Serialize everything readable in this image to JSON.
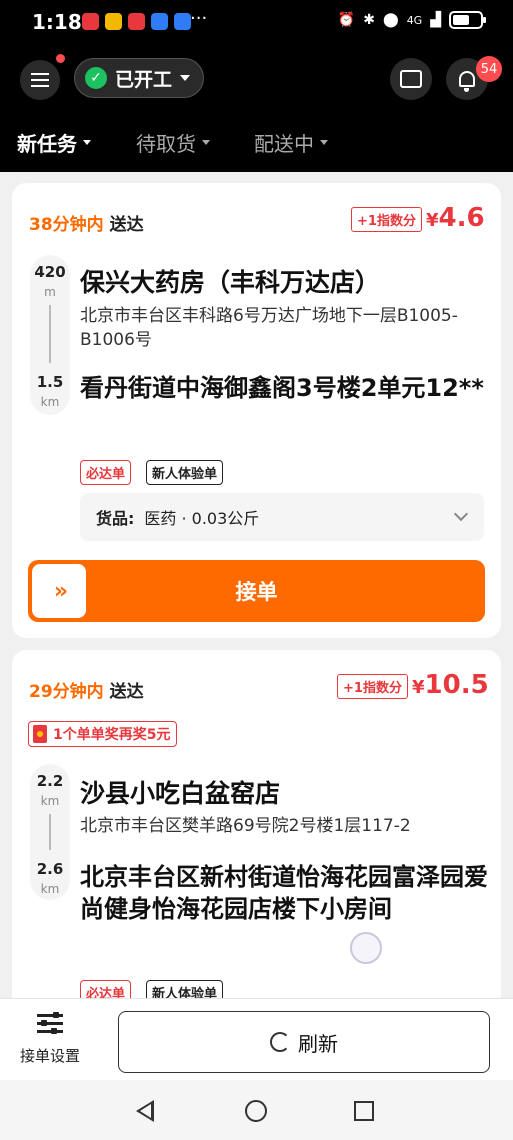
{
  "status_bar": {
    "time": "1:18",
    "more": "···",
    "network": "4G",
    "app_icons": [
      {
        "name": "app-icon-1",
        "color": "#e8383d"
      },
      {
        "name": "app-icon-2",
        "color": "#f5b800"
      },
      {
        "name": "app-icon-3",
        "color": "#e8383d"
      },
      {
        "name": "app-icon-4",
        "color": "#2f7cf6"
      },
      {
        "name": "app-icon-5",
        "color": "#2f7cf6"
      }
    ]
  },
  "header": {
    "work_status": "已开工",
    "notification_count": "54",
    "tabs": [
      "新任务",
      "待取货",
      "配送中"
    ]
  },
  "orders": [
    {
      "minutes": "38分钟内",
      "deliver_word": "送达",
      "index_tag": "+1指数分",
      "price_symbol": "¥",
      "price": "4.6",
      "pickup_distance": "420",
      "pickup_unit": "m",
      "drop_distance": "1.5",
      "drop_unit": "km",
      "shop_name": "保兴大药房（丰科万达店）",
      "shop_address": "北京市丰台区丰科路6号万达广场地下一层B1005-B1006号",
      "destination": "看丹街道中海御鑫阁3号楼2单元12**",
      "tags": [
        "必达单",
        "新人体验单"
      ],
      "goods_label": "货品:",
      "goods_value": "医药 · 0.03公斤",
      "accept_label": "接单",
      "accept_handle": "»"
    },
    {
      "minutes": "29分钟内",
      "deliver_word": "送达",
      "index_tag": "+1指数分",
      "price_symbol": "¥",
      "price": "10.5",
      "bonus": "1个单单奖再奖5元",
      "pickup_distance": "2.2",
      "pickup_unit": "km",
      "drop_distance": "2.6",
      "drop_unit": "km",
      "shop_name": "沙县小吃白盆窑店",
      "shop_address": "北京市丰台区樊羊路69号院2号楼1层117-2",
      "destination": "北京丰台区新村街道怡海花园富泽园爱尚健身怡海花园店楼下小房间",
      "tags": [
        "必达单",
        "新人体验单"
      ]
    }
  ],
  "bottom_bar": {
    "settings_label": "接单设置",
    "refresh_label": "刷新"
  },
  "colors": {
    "accent": "#ff6a00",
    "price_red": "#e8383d",
    "online_green": "#1ec15f"
  }
}
